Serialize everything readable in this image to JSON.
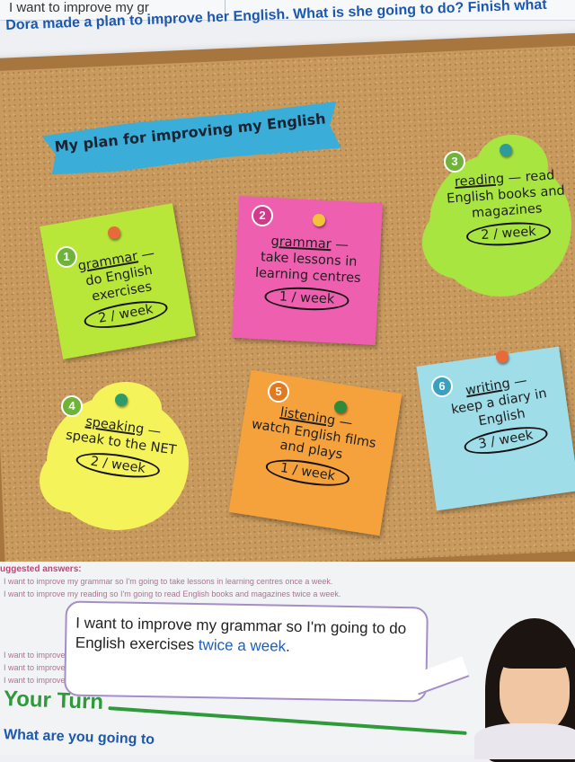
{
  "header": {
    "top_text": "I want to improve my gr",
    "instruction": "Dora made a plan to improve her English. What is she going to do? Finish what"
  },
  "board": {
    "title": "My plan for improving my English",
    "notes": [
      {
        "number": "1",
        "skill": "grammar",
        "dash": " —",
        "activity": "do English exercises",
        "frequency": "2 / week",
        "color": "#b8e639"
      },
      {
        "number": "2",
        "skill": "grammar",
        "dash": " —",
        "activity": "take lessons in learning centres",
        "frequency": "1 / week",
        "color": "#ee5fb0"
      },
      {
        "number": "3",
        "skill": "reading",
        "dash": " — read",
        "activity": "English books and magazines",
        "frequency": "2 / week",
        "color": "#a9e540"
      },
      {
        "number": "4",
        "skill": "speaking",
        "dash": " —",
        "activity": "speak to the NET",
        "frequency": "2 / week",
        "color": "#f4f45a"
      },
      {
        "number": "5",
        "skill": "listening",
        "dash": " —",
        "activity": "watch English films and plays",
        "frequency": "1 / week",
        "color": "#f6a23c"
      },
      {
        "number": "6",
        "skill": "writing",
        "dash": " —",
        "activity": "keep a diary in English",
        "frequency": "3 / week",
        "color": "#9fdde8"
      }
    ]
  },
  "answers": {
    "label": "uggested answers:",
    "lines": [
      "I want to improve my grammar so I'm going to take lessons in learning centres once a week.",
      "I want to improve my reading so I'm going to read English books and magazines twice a week.",
      "I want to improve my speaking so I'm going to speak to the NET twice a week.",
      "I want to improve my listening so I'm going to watch English films and plays once a week.",
      "I want to improve my writing so I'm going to keep a diary in English three times a week."
    ],
    "bubble_main": "I want to improve my grammar so I'm going to do English exercises ",
    "bubble_highlight": "twice a week",
    "bubble_end": "."
  },
  "your_turn": {
    "heading": "Your Turn",
    "question": "What are you going to"
  },
  "colors": {
    "accent_blue": "#1b58b0",
    "cork": "#c89a5e",
    "frame": "#a7763f",
    "your_turn_green": "#2e9a3a"
  }
}
